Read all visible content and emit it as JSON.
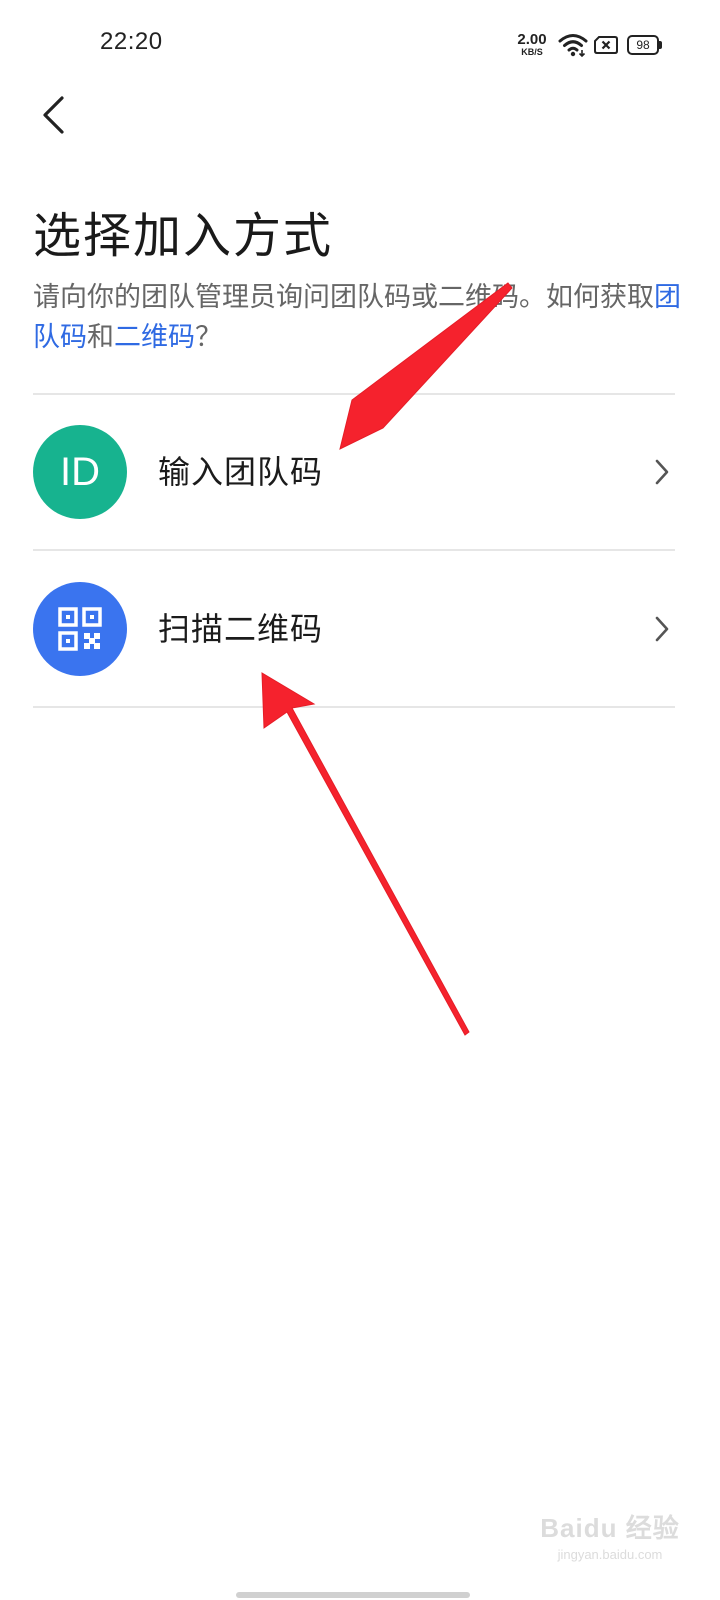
{
  "status_bar": {
    "time": "22:20",
    "net_speed_value": "2.00",
    "net_speed_unit": "KB/S",
    "battery_level": "98",
    "icons": [
      "wifi-icon",
      "sim-card-no-signal-icon",
      "battery-icon"
    ]
  },
  "nav": {
    "back_icon": "chevron-left-icon"
  },
  "page": {
    "title": "选择加入方式",
    "desc_prefix": "请向你的团队管理员询问团队码或二维码。如何获取",
    "desc_link_team_code": "团队码",
    "desc_and": "和",
    "desc_link_qr": "二维码",
    "desc_suffix": "？"
  },
  "options": [
    {
      "avatar_text": "ID",
      "avatar_icon": "id-badge-icon",
      "label": "输入团队码",
      "color": "#17b38f"
    },
    {
      "avatar_icon": "qr-code-icon",
      "label": "扫描二维码",
      "color": "#3a74ef"
    }
  ],
  "annotations": {
    "arrow_color": "#f5222d"
  },
  "watermark": {
    "main": "Baidu 经验",
    "sub": "jingyan.baidu.com"
  }
}
